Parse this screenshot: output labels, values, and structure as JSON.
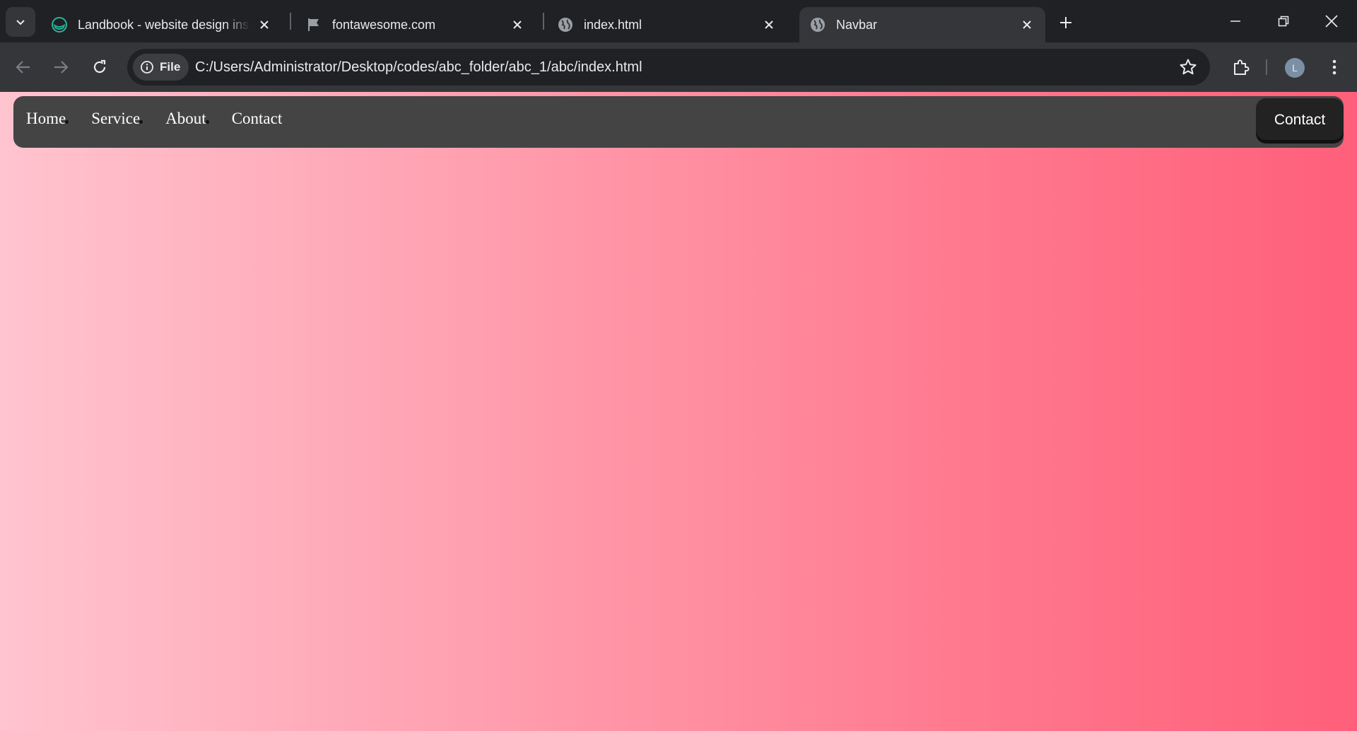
{
  "browser": {
    "tabs": [
      {
        "title": "Landbook - website design insp",
        "favicon": "landbook-icon"
      },
      {
        "title": "fontawesome.com",
        "favicon": "flag-icon"
      },
      {
        "title": "index.html",
        "favicon": "globe-icon"
      },
      {
        "title": "Navbar",
        "favicon": "globe-icon",
        "active": true
      }
    ],
    "address_bar": {
      "chip_label": "File",
      "url": "C:/Users/Administrator/Desktop/codes/abc_folder/abc_1/abc/index.html"
    },
    "profile_initial": "L"
  },
  "page": {
    "nav_links": [
      "Home",
      "Service",
      "About",
      "Contact"
    ],
    "cta_label": "Contact",
    "colors": {
      "navbar": "#444444",
      "cta": "#222222",
      "gradient_start": "#ffc4cf",
      "gradient_end": "#ff5f7a"
    }
  }
}
